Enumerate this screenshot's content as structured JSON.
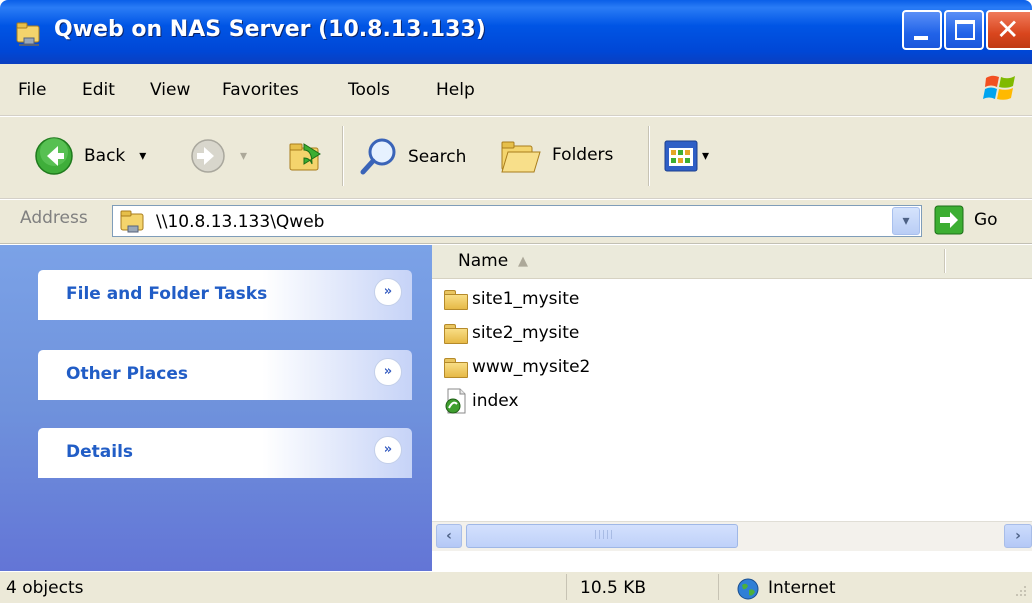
{
  "window": {
    "title": "Qweb on NAS Server (10.8.13.133)",
    "close_glyph": "✕"
  },
  "menu": {
    "items": [
      "File",
      "Edit",
      "View",
      "Favorites",
      "Tools",
      "Help"
    ]
  },
  "toolbar": {
    "back_label": "Back",
    "back_dropdown": "▾",
    "search_label": "Search",
    "folders_label": "Folders",
    "views_dropdown": "▾"
  },
  "address": {
    "label": "Address",
    "value": "\\\\10.8.13.133\\Qweb",
    "go_label": "Go",
    "dropdown_glyph": "▾"
  },
  "tasks": [
    {
      "title": "File and Folder Tasks",
      "chevron": "»"
    },
    {
      "title": "Other Places",
      "chevron": "»"
    },
    {
      "title": "Details",
      "chevron": "»"
    }
  ],
  "list": {
    "column_name": "Name",
    "sort_glyph": "▲",
    "items": [
      {
        "name": "site1_mysite",
        "icon": "folder-icon"
      },
      {
        "name": "site2_mysite",
        "icon": "folder-icon"
      },
      {
        "name": "www_mysite2",
        "icon": "folder-icon"
      },
      {
        "name": "index",
        "icon": "html-file-icon"
      }
    ]
  },
  "scrollbar": {
    "left_glyph": "‹",
    "right_glyph": "›",
    "grip": "|||||"
  },
  "status": {
    "objects": "4 objects",
    "size": "10.5 KB",
    "zone": "Internet"
  }
}
